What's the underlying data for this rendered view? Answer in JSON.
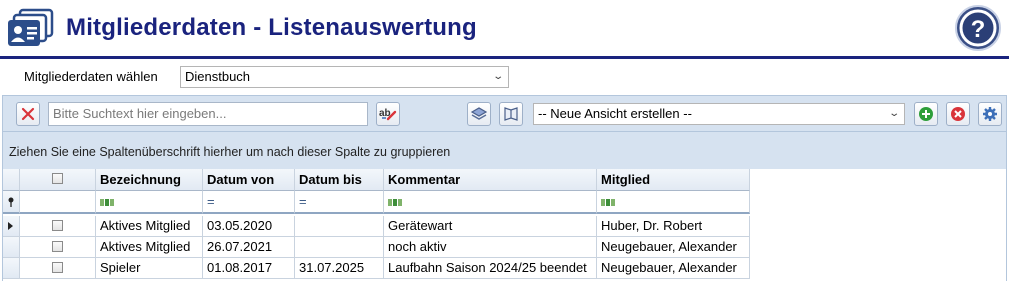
{
  "header": {
    "title": "Mitgliederdaten - Listenauswertung",
    "help_label": "?"
  },
  "selector": {
    "label": "Mitgliederdaten wählen",
    "value": "Dienstbuch"
  },
  "toolbar": {
    "search_placeholder": "Bitte Suchtext hier eingeben...",
    "view_select_value": "-- Neue Ansicht erstellen --"
  },
  "group_panel": {
    "hint": "Ziehen Sie eine Spaltenüberschrift hierher um nach dieser Spalte zu gruppieren"
  },
  "grid": {
    "columns": [
      "Bezeichnung",
      "Datum von",
      "Datum bis",
      "Kommentar",
      "Mitglied"
    ],
    "filter_row": [
      "abc",
      "=",
      "=",
      "abc",
      "abc"
    ],
    "rows": [
      [
        "Aktives Mitglied",
        "03.05.2020",
        "",
        "Gerätewart",
        "Huber, Dr. Robert"
      ],
      [
        "Aktives Mitglied",
        "26.07.2021",
        "",
        "noch aktiv",
        "Neugebauer, Alexander"
      ],
      [
        "Spieler",
        "01.08.2017",
        "31.07.2025",
        "Laufbahn Saison 2024/25 beendet",
        "Neugebauer, Alexander"
      ]
    ]
  },
  "colors": {
    "title": "#1a237e",
    "toolbar_bg": "#d6e2f0",
    "add_green": "#2e9e3a",
    "delete_red": "#d9343a",
    "settings_blue": "#3d6fb8"
  }
}
